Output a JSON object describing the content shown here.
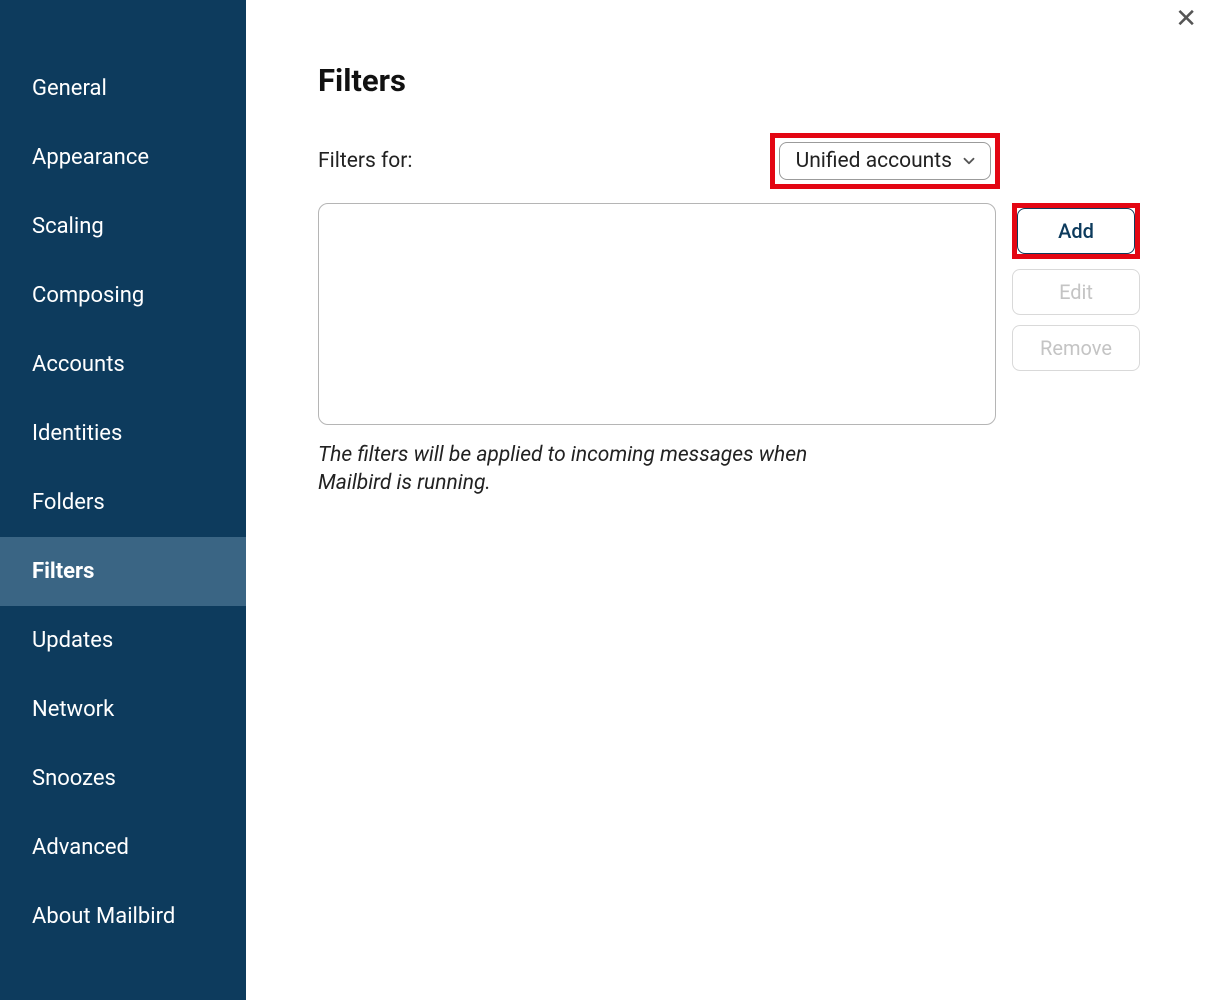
{
  "sidebar": {
    "items": [
      {
        "label": "General"
      },
      {
        "label": "Appearance"
      },
      {
        "label": "Scaling"
      },
      {
        "label": "Composing"
      },
      {
        "label": "Accounts"
      },
      {
        "label": "Identities"
      },
      {
        "label": "Folders"
      },
      {
        "label": "Filters"
      },
      {
        "label": "Updates"
      },
      {
        "label": "Network"
      },
      {
        "label": "Snoozes"
      },
      {
        "label": "Advanced"
      },
      {
        "label": "About Mailbird"
      }
    ],
    "active_index": 7
  },
  "main": {
    "title": "Filters",
    "filters_for_label": "Filters for:",
    "account_dropdown": {
      "selected": "Unified accounts"
    },
    "buttons": {
      "add": "Add",
      "edit": "Edit",
      "remove": "Remove"
    },
    "help_text": "The filters will be applied to incoming messages when Mailbird is running."
  },
  "annotations": {
    "dropdown_highlight_color": "#e30613",
    "add_button_highlight_color": "#e30613"
  }
}
